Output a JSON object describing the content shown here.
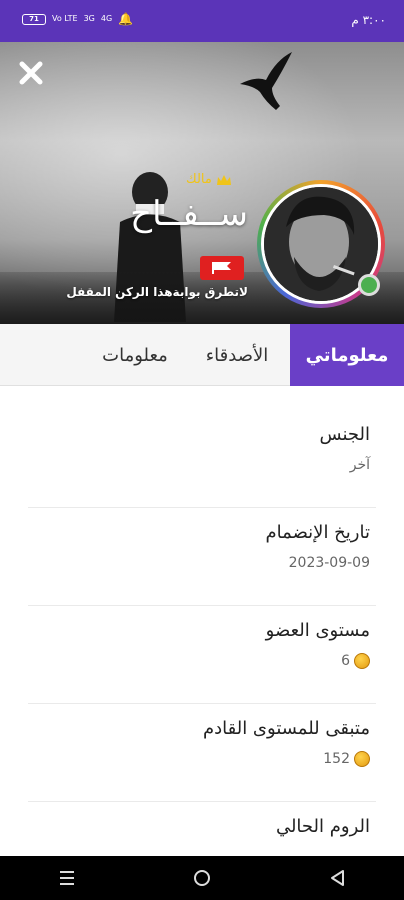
{
  "status_bar": {
    "time": "٣:٠٠ م",
    "battery": "71",
    "signal_1": "Vo LTE",
    "signal_2": "4G",
    "signal_3": "3G"
  },
  "profile": {
    "owner_label": "مالك",
    "username": "ســفــاح",
    "bio": "لاتطرق بوابةهذا الركن المقفل"
  },
  "tabs": [
    {
      "label": "معلوماتي"
    },
    {
      "label": "الأصدقاء"
    },
    {
      "label": "معلومات"
    }
  ],
  "info": [
    {
      "label": "الجنس",
      "value": "آخر"
    },
    {
      "label": "تاريخ الإنضمام",
      "value": "2023-09-09"
    },
    {
      "label": "مستوى العضو",
      "value": "6"
    },
    {
      "label": "متبقى للمستوى القادم",
      "value": "152"
    },
    {
      "label": "الروم الحالي",
      "value": ""
    }
  ],
  "colors": {
    "status_bar": "#5b34b8",
    "tab_active": "#6a3fc7",
    "online": "#4caf50",
    "badge_red": "#e02020"
  }
}
